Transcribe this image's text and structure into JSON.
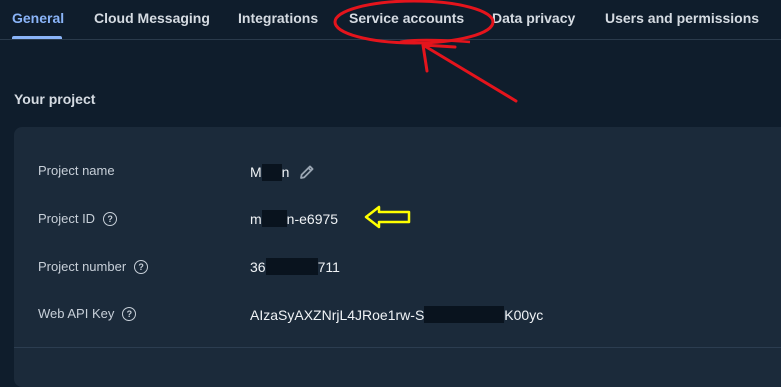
{
  "tabs": [
    {
      "label": "General",
      "active": true
    },
    {
      "label": "Cloud Messaging"
    },
    {
      "label": "Integrations"
    },
    {
      "label": "Service accounts"
    },
    {
      "label": "Data privacy"
    },
    {
      "label": "Users and permissions"
    }
  ],
  "section_title": "Your project",
  "project": {
    "name_label": "Project name",
    "name_prefix": "M",
    "name_suffix": "n",
    "id_label": "Project ID",
    "id_prefix": "m",
    "id_suffix": "n-e6975",
    "number_label": "Project number",
    "number_prefix": "36",
    "number_suffix": "711",
    "api_key_label": "Web API Key",
    "api_key_prefix": "AIzaSyAXZNrjL4JRoe1rw-S",
    "api_key_suffix": "K00yc"
  },
  "icons": {
    "edit": "pencil-icon",
    "help": "help-circle-icon"
  },
  "annotation_colors": {
    "red_circle": "#e4141c",
    "yellow_arrow": "#ffff00"
  }
}
